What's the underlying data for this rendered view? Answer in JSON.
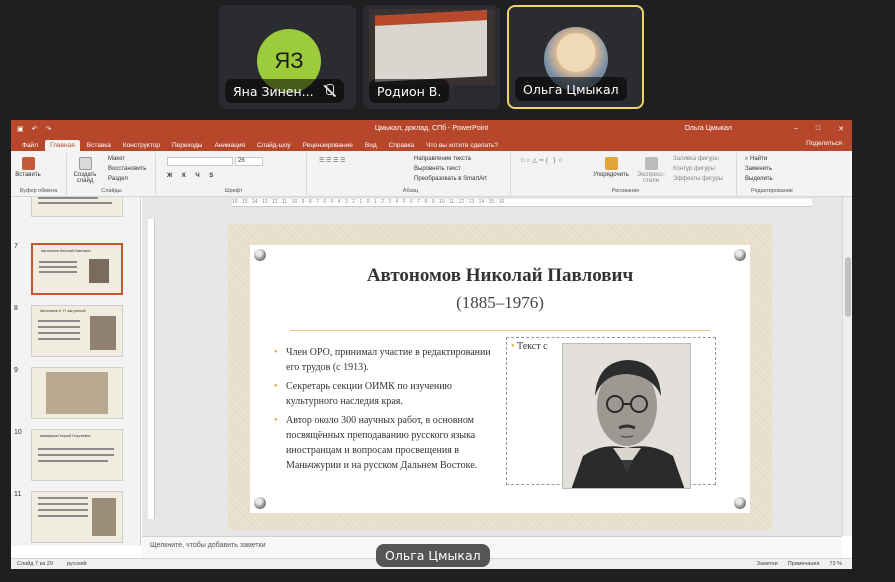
{
  "participants": [
    {
      "name": "Яна Зинен...",
      "initials": "ЯЗ",
      "muted": true
    },
    {
      "name": "Родион В.",
      "video": true
    },
    {
      "name": "Ольга Цмыкал",
      "active_speaker": true
    }
  ],
  "powerpoint": {
    "window_title": "Цмыкал, доклад, СПб  -  PowerPoint",
    "user": "Ольга Цмыкал",
    "tabs": [
      "Файл",
      "Главная",
      "Вставка",
      "Конструктор",
      "Переходы",
      "Анимация",
      "Слайд-шоу",
      "Рецензирование",
      "Вид",
      "Справка",
      "Что вы хотите сделать?"
    ],
    "active_tab": "Главная",
    "share_label": "Поделиться",
    "ribbon": {
      "paste": "Вставить",
      "new_slide": "Создать слайд",
      "layout": "Макет",
      "reset": "Восстановить",
      "section": "Раздел",
      "font_size": "26",
      "text_direction": "Направление текста",
      "align_text": "Выровнять текст",
      "smartart": "Преобразовать в SmartArt",
      "arrange": "Упорядочить",
      "quick_styles": "Экспресс-стили",
      "shape_fill": "Заливка фигуры",
      "shape_outline": "Контур фигуры",
      "shape_effects": "Эффекты фигуры",
      "find": "Найти",
      "replace": "Заменить",
      "select": "Выделить",
      "groups": [
        "Буфер обмена",
        "Слайды",
        "Шрифт",
        "Абзац",
        "Рисование",
        "Редактирование"
      ]
    },
    "thumbnails": [
      {
        "number": "7",
        "title": "Автономов Николай Павлович"
      },
      {
        "number": "8",
        "title": "Автономов Н. П. как ученый"
      },
      {
        "number": "9",
        "title": ""
      },
      {
        "number": "10",
        "title": "Аввакумов Георгий Георгиевич"
      },
      {
        "number": "11",
        "title": ""
      }
    ],
    "ruler_text": "16 · 15 · 14 · 13 · 12 · 11 · 10 · 9 · 8 · 7 · 6 · 5 · 4 · 3 · 2 · 1 · 0 · 1 · 2 · 3 · 4 · 5 · 6 · 7 · 8 · 9 · 10 · 11 · 12 · 13 · 14 · 15 · 16",
    "slide": {
      "title": "Автономов Николай Павлович",
      "subtitle": "(1885–1976)",
      "bullets": [
        "Член ОРО, принимал участие в редактировании его трудов (с 1913).",
        "Секретарь секции ОИМК по изучению культурного наследия края.",
        "Автор около 300 научных работ, в основном посвящённых преподаванию русского языка иностранцам и вопросам просвещения в Маньчжурии и на русском Дальнем Востоке."
      ],
      "placeholder_text": "Текст с"
    },
    "notes_placeholder": "Щелкните, чтобы добавить заметки",
    "status": {
      "slide_info": "Слайд 7 из 29",
      "language": "русский",
      "notes": "Заметки",
      "comments": "Примечания",
      "zoom": "73 %"
    }
  },
  "speaker_label": "Ольга Цмыкал"
}
